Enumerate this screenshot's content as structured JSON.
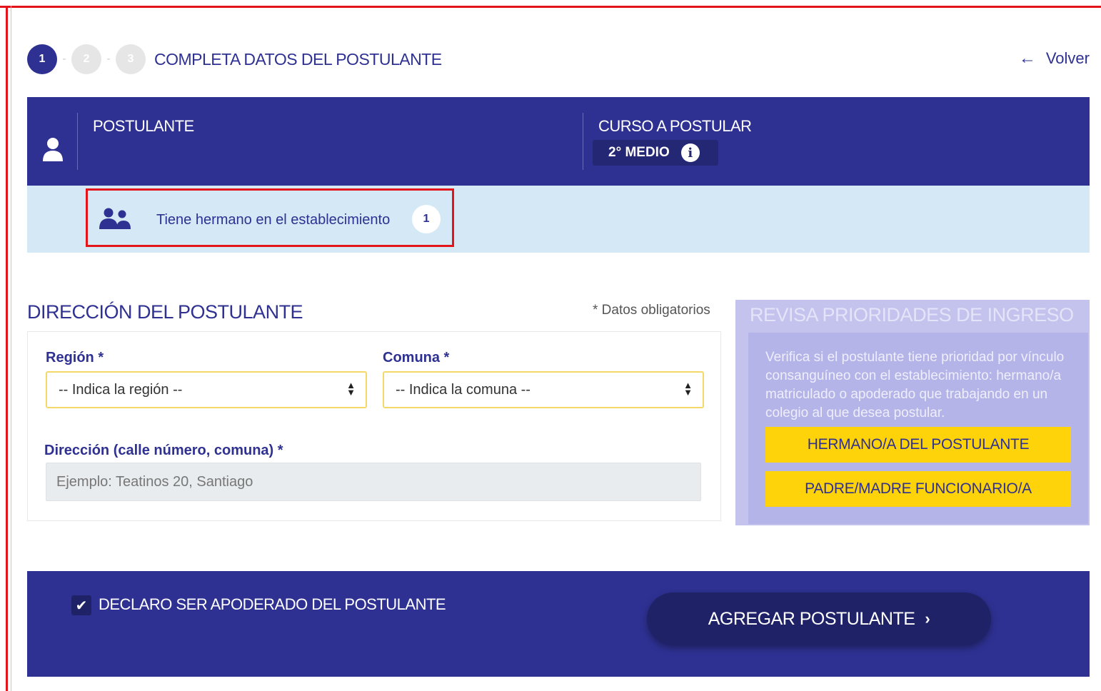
{
  "steps": {
    "items": [
      "1",
      "2",
      "3"
    ],
    "title": "COMPLETA DATOS DEL POSTULANTE"
  },
  "nav": {
    "back_label": "Volver"
  },
  "header": {
    "postulante_label": "POSTULANTE",
    "curso_label": "CURSO A POSTULAR",
    "curso_value": "2° MEDIO"
  },
  "sibling": {
    "text": "Tiene hermano en el establecimiento",
    "count": "1"
  },
  "address": {
    "title": "DIRECCIÓN DEL POSTULANTE",
    "required_note": "* Datos obligatorios",
    "region_label": "Región *",
    "region_value": "-- Indica la región --",
    "comuna_label": "Comuna *",
    "comuna_value": "-- Indica la comuna --",
    "direccion_label": "Dirección (calle número, comuna) *",
    "direccion_placeholder": "Ejemplo: Teatinos 20, Santiago"
  },
  "priorities": {
    "title": "REVISA PRIORIDADES DE INGRESO",
    "description": "Verifica si el postulante tiene prioridad por vínculo consanguíneo con el establecimiento: hermano/a matriculado o apoderado que trabajando en un colegio al que desea postular.",
    "button_sibling": "HERMANO/A DEL POSTULANTE",
    "button_parent": "PADRE/MADRE FUNCIONARIO/A"
  },
  "footer": {
    "declaration": "DECLARO SER APODERADO DEL POSTULANTE",
    "declaration_checked": true,
    "add_button": "AGREGAR POSTULANTE"
  },
  "colors": {
    "primary": "#2e3192",
    "highlight_border": "#e3151b",
    "light_blue": "#d4e8f5",
    "yellow": "#ffd30a",
    "lavender": "#c3c3ee"
  }
}
